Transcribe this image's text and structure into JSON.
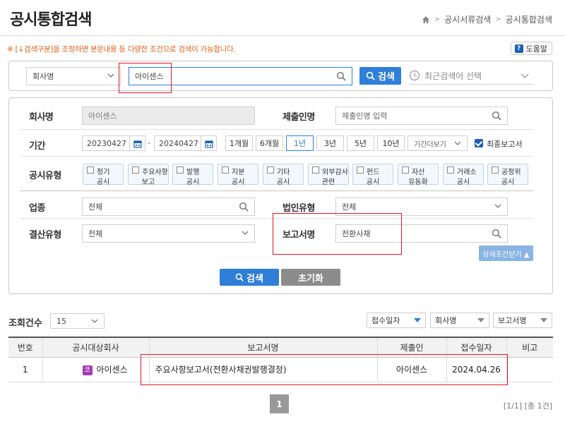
{
  "header": {
    "title": "공시통합검색",
    "breadcrumb": [
      "공시서류검색",
      "공시통합검색"
    ],
    "notice": "※ [↓검색구분]을 조정하면 본문내용 등 다양한 조건으로 검색이 가능합니다.",
    "help_label": "도움말",
    "help_icon": "?"
  },
  "quick_search": {
    "category": "회사명",
    "query": "아이센스",
    "search_label": "검색",
    "recent_placeholder": "최근검색어 선택"
  },
  "detail": {
    "company_label": "회사명",
    "company_value": "아이센스",
    "submitter_label": "제출인명",
    "submitter_placeholder": "제출인명 입력",
    "period_label": "기간",
    "date_from": "20230427",
    "date_sep": "-",
    "date_to": "20240427",
    "period_buttons": [
      "1개월",
      "6개월",
      "1년",
      "3년",
      "5년",
      "10년"
    ],
    "period_active": "1년",
    "period_more": "기간더보기",
    "final_report_label": "최종보고서",
    "disclosure_type_label": "공시유형",
    "disclosure_types": [
      {
        "line1": "정기",
        "line2": "공시"
      },
      {
        "line1": "주요사항",
        "line2": "보고"
      },
      {
        "line1": "발행",
        "line2": "공시"
      },
      {
        "line1": "지분",
        "line2": "공시"
      },
      {
        "line1": "기타",
        "line2": "공시"
      },
      {
        "line1": "외부감사",
        "line2": "관련"
      },
      {
        "line1": "펀드",
        "line2": "공시"
      },
      {
        "line1": "자산",
        "line2": "유동화"
      },
      {
        "line1": "거래소",
        "line2": "공시"
      },
      {
        "line1": "공정위",
        "line2": "공시"
      }
    ],
    "industry_label": "업종",
    "industry_value": "전체",
    "corp_type_label": "법인유형",
    "corp_type_value": "전체",
    "settlement_label": "결산유형",
    "settlement_value": "전체",
    "report_name_label": "보고서명",
    "report_name_value": "전환사채",
    "collapse_label": "상세조건닫기 ▲",
    "search_label": "검색",
    "reset_label": "초기화"
  },
  "results": {
    "count_label": "조회건수",
    "page_size": "15",
    "sort_options": [
      "접수일자",
      "회사명",
      "보고서명"
    ],
    "columns": [
      "번호",
      "공시대상회사",
      "보고서명",
      "제출인",
      "접수일자",
      "비고"
    ],
    "rows": [
      {
        "no": "1",
        "badge": "코",
        "company": "아이센스",
        "report": "주요사항보고서(전환사채권발행결정)",
        "submitter": "아이센스",
        "date": "2024.04.26",
        "note": ""
      }
    ],
    "current_page": "1",
    "page_info": "[1/1] [총 1건]"
  },
  "colors": {
    "accent": "#2f7ed8",
    "notice": "#e0601a",
    "highlight_box": "#e0152a",
    "badge_kosdaq": "#a33bb5"
  },
  "icons": {
    "home": "home-icon",
    "search": "search-icon",
    "calendar": "calendar-icon",
    "clock": "clock-icon",
    "chevron": "chevron-down-icon"
  }
}
